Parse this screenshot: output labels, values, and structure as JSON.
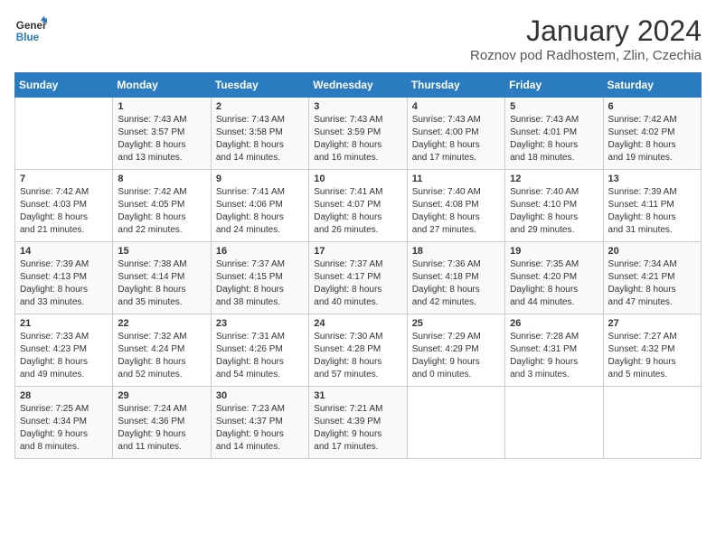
{
  "header": {
    "logo_line1": "General",
    "logo_line2": "Blue",
    "month_year": "January 2024",
    "location": "Roznov pod Radhostem, Zlin, Czechia"
  },
  "weekdays": [
    "Sunday",
    "Monday",
    "Tuesday",
    "Wednesday",
    "Thursday",
    "Friday",
    "Saturday"
  ],
  "weeks": [
    [
      {
        "day": "",
        "info": ""
      },
      {
        "day": "1",
        "info": "Sunrise: 7:43 AM\nSunset: 3:57 PM\nDaylight: 8 hours\nand 13 minutes."
      },
      {
        "day": "2",
        "info": "Sunrise: 7:43 AM\nSunset: 3:58 PM\nDaylight: 8 hours\nand 14 minutes."
      },
      {
        "day": "3",
        "info": "Sunrise: 7:43 AM\nSunset: 3:59 PM\nDaylight: 8 hours\nand 16 minutes."
      },
      {
        "day": "4",
        "info": "Sunrise: 7:43 AM\nSunset: 4:00 PM\nDaylight: 8 hours\nand 17 minutes."
      },
      {
        "day": "5",
        "info": "Sunrise: 7:43 AM\nSunset: 4:01 PM\nDaylight: 8 hours\nand 18 minutes."
      },
      {
        "day": "6",
        "info": "Sunrise: 7:42 AM\nSunset: 4:02 PM\nDaylight: 8 hours\nand 19 minutes."
      }
    ],
    [
      {
        "day": "7",
        "info": "Sunrise: 7:42 AM\nSunset: 4:03 PM\nDaylight: 8 hours\nand 21 minutes."
      },
      {
        "day": "8",
        "info": "Sunrise: 7:42 AM\nSunset: 4:05 PM\nDaylight: 8 hours\nand 22 minutes."
      },
      {
        "day": "9",
        "info": "Sunrise: 7:41 AM\nSunset: 4:06 PM\nDaylight: 8 hours\nand 24 minutes."
      },
      {
        "day": "10",
        "info": "Sunrise: 7:41 AM\nSunset: 4:07 PM\nDaylight: 8 hours\nand 26 minutes."
      },
      {
        "day": "11",
        "info": "Sunrise: 7:40 AM\nSunset: 4:08 PM\nDaylight: 8 hours\nand 27 minutes."
      },
      {
        "day": "12",
        "info": "Sunrise: 7:40 AM\nSunset: 4:10 PM\nDaylight: 8 hours\nand 29 minutes."
      },
      {
        "day": "13",
        "info": "Sunrise: 7:39 AM\nSunset: 4:11 PM\nDaylight: 8 hours\nand 31 minutes."
      }
    ],
    [
      {
        "day": "14",
        "info": "Sunrise: 7:39 AM\nSunset: 4:13 PM\nDaylight: 8 hours\nand 33 minutes."
      },
      {
        "day": "15",
        "info": "Sunrise: 7:38 AM\nSunset: 4:14 PM\nDaylight: 8 hours\nand 35 minutes."
      },
      {
        "day": "16",
        "info": "Sunrise: 7:37 AM\nSunset: 4:15 PM\nDaylight: 8 hours\nand 38 minutes."
      },
      {
        "day": "17",
        "info": "Sunrise: 7:37 AM\nSunset: 4:17 PM\nDaylight: 8 hours\nand 40 minutes."
      },
      {
        "day": "18",
        "info": "Sunrise: 7:36 AM\nSunset: 4:18 PM\nDaylight: 8 hours\nand 42 minutes."
      },
      {
        "day": "19",
        "info": "Sunrise: 7:35 AM\nSunset: 4:20 PM\nDaylight: 8 hours\nand 44 minutes."
      },
      {
        "day": "20",
        "info": "Sunrise: 7:34 AM\nSunset: 4:21 PM\nDaylight: 8 hours\nand 47 minutes."
      }
    ],
    [
      {
        "day": "21",
        "info": "Sunrise: 7:33 AM\nSunset: 4:23 PM\nDaylight: 8 hours\nand 49 minutes."
      },
      {
        "day": "22",
        "info": "Sunrise: 7:32 AM\nSunset: 4:24 PM\nDaylight: 8 hours\nand 52 minutes."
      },
      {
        "day": "23",
        "info": "Sunrise: 7:31 AM\nSunset: 4:26 PM\nDaylight: 8 hours\nand 54 minutes."
      },
      {
        "day": "24",
        "info": "Sunrise: 7:30 AM\nSunset: 4:28 PM\nDaylight: 8 hours\nand 57 minutes."
      },
      {
        "day": "25",
        "info": "Sunrise: 7:29 AM\nSunset: 4:29 PM\nDaylight: 9 hours\nand 0 minutes."
      },
      {
        "day": "26",
        "info": "Sunrise: 7:28 AM\nSunset: 4:31 PM\nDaylight: 9 hours\nand 3 minutes."
      },
      {
        "day": "27",
        "info": "Sunrise: 7:27 AM\nSunset: 4:32 PM\nDaylight: 9 hours\nand 5 minutes."
      }
    ],
    [
      {
        "day": "28",
        "info": "Sunrise: 7:25 AM\nSunset: 4:34 PM\nDaylight: 9 hours\nand 8 minutes."
      },
      {
        "day": "29",
        "info": "Sunrise: 7:24 AM\nSunset: 4:36 PM\nDaylight: 9 hours\nand 11 minutes."
      },
      {
        "day": "30",
        "info": "Sunrise: 7:23 AM\nSunset: 4:37 PM\nDaylight: 9 hours\nand 14 minutes."
      },
      {
        "day": "31",
        "info": "Sunrise: 7:21 AM\nSunset: 4:39 PM\nDaylight: 9 hours\nand 17 minutes."
      },
      {
        "day": "",
        "info": ""
      },
      {
        "day": "",
        "info": ""
      },
      {
        "day": "",
        "info": ""
      }
    ]
  ]
}
